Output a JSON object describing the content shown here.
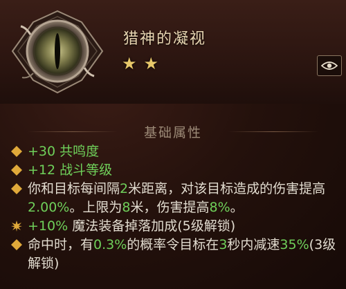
{
  "item": {
    "name": "猎神的凝视",
    "stars": [
      "★",
      "★"
    ]
  },
  "section": {
    "title": "基础属性"
  },
  "properties": [
    {
      "type": "diamond",
      "parts": [
        {
          "t": "+30 共鸣度",
          "c": "g"
        }
      ]
    },
    {
      "type": "diamond",
      "parts": [
        {
          "t": "+12 战斗等级",
          "c": "g"
        }
      ]
    },
    {
      "type": "diamond",
      "parts": [
        {
          "t": "你和目标每间隔",
          "c": "w"
        },
        {
          "t": "2",
          "c": "g"
        },
        {
          "t": "米距离，对该目标造成的伤害提高",
          "c": "w"
        },
        {
          "t": "2.00%",
          "c": "g"
        },
        {
          "t": "。上限为",
          "c": "w"
        },
        {
          "t": "8",
          "c": "g"
        },
        {
          "t": "米，伤害提高",
          "c": "w"
        },
        {
          "t": "8%",
          "c": "g"
        },
        {
          "t": "。",
          "c": "w"
        }
      ]
    },
    {
      "type": "burst",
      "parts": [
        {
          "t": "+10%",
          "c": "g"
        },
        {
          "t": " 魔法装备掉落加成(5级解锁)",
          "c": "w"
        }
      ]
    },
    {
      "type": "diamond",
      "parts": [
        {
          "t": "命中时，有",
          "c": "w"
        },
        {
          "t": "0.3%",
          "c": "g"
        },
        {
          "t": "的概率令目标在",
          "c": "w"
        },
        {
          "t": "3",
          "c": "g"
        },
        {
          "t": "秒内减速",
          "c": "w"
        },
        {
          "t": "35%",
          "c": "g"
        },
        {
          "t": "(3级解锁)",
          "c": "w"
        }
      ]
    }
  ],
  "colors": {
    "highlight": "#6fd05a",
    "text": "#e2dcd0",
    "bullet": "#e0a93a"
  },
  "icons": {
    "gem": "eye-gem-icon",
    "view": "eye-view-icon",
    "bullet": "diamond-bullet-icon",
    "burst": "burst-bullet-icon"
  }
}
